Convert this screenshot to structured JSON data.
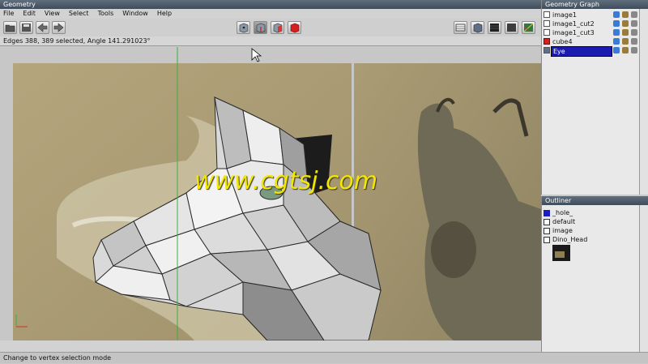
{
  "window": {
    "title": "Geometry"
  },
  "menu": [
    "File",
    "Edit",
    "View",
    "Select",
    "Tools",
    "Window",
    "Help"
  ],
  "status_text": "Edges 388, 389 selected, Angle 141.291023°",
  "bottom_status": "Change to vertex selection mode",
  "watermark": "www.cgtsj.com",
  "geometry_graph": {
    "title": "Geometry Graph",
    "items": [
      {
        "label": "image1",
        "selected": false
      },
      {
        "label": "image1_cut2",
        "selected": false
      },
      {
        "label": "image1_cut3",
        "selected": false
      },
      {
        "label": "cube4",
        "selected": false
      },
      {
        "label": "Eye",
        "selected": true
      }
    ]
  },
  "outliner": {
    "title": "Outliner",
    "items": [
      {
        "label": "_hole_",
        "color": "#1c1cc4"
      },
      {
        "label": "default",
        "color": "#ffffff"
      },
      {
        "label": "image",
        "color": "#ffffff"
      },
      {
        "label": "Dino_Head",
        "color": "#ffffff"
      }
    ]
  },
  "colors": {
    "accent": "#1b1bb0",
    "titlebar": "#4b5866",
    "watermark": "#f3e600",
    "axis_line": "#3fae3f"
  }
}
